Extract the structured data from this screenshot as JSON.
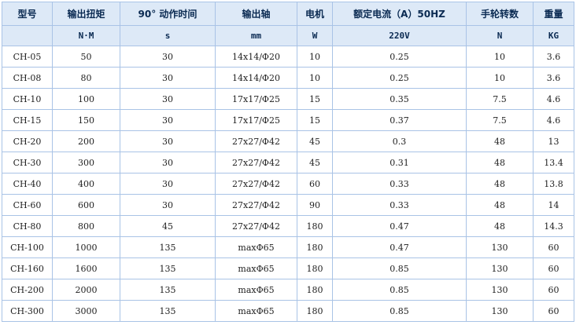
{
  "table": {
    "headers": [
      "型号",
      "输出扭矩",
      "90° 动作时间",
      "输出轴",
      "电机",
      "额定电流（A）50HZ",
      "手轮转数",
      "重量"
    ],
    "units": [
      "",
      "N·M",
      "s",
      "mm",
      "W",
      "220V",
      "N",
      "KG"
    ],
    "rows": [
      [
        "CH-05",
        "50",
        "30",
        "14x14/Φ20",
        "10",
        "0.25",
        "10",
        "3.6"
      ],
      [
        "CH-08",
        "80",
        "30",
        "14x14/Φ20",
        "10",
        "0.25",
        "10",
        "3.6"
      ],
      [
        "CH-10",
        "100",
        "30",
        "17x17/Φ25",
        "15",
        "0.35",
        "7.5",
        "4.6"
      ],
      [
        "CH-15",
        "150",
        "30",
        "17x17/Φ25",
        "15",
        "0.37",
        "7.5",
        "4.6"
      ],
      [
        "CH-20",
        "200",
        "30",
        "27x27/Φ42",
        "45",
        "0.3",
        "48",
        "13"
      ],
      [
        "CH-30",
        "300",
        "30",
        "27x27/Φ42",
        "45",
        "0.31",
        "48",
        "13.4"
      ],
      [
        "CH-40",
        "400",
        "30",
        "27x27/Φ42",
        "60",
        "0.33",
        "48",
        "13.8"
      ],
      [
        "CH-60",
        "600",
        "30",
        "27x27/Φ42",
        "90",
        "0.33",
        "48",
        "14"
      ],
      [
        "CH-80",
        "800",
        "45",
        "27x27/Φ42",
        "180",
        "0.47",
        "48",
        "14.3"
      ],
      [
        "CH-100",
        "1000",
        "135",
        "maxΦ65",
        "180",
        "0.47",
        "130",
        "60"
      ],
      [
        "CH-160",
        "1600",
        "135",
        "maxΦ65",
        "180",
        "0.85",
        "130",
        "60"
      ],
      [
        "CH-200",
        "2000",
        "135",
        "maxΦ65",
        "180",
        "0.85",
        "130",
        "60"
      ],
      [
        "CH-300",
        "3000",
        "135",
        "maxΦ65",
        "180",
        "0.85",
        "130",
        "60"
      ]
    ]
  },
  "colors": {
    "header_bg": "#dde9f7",
    "header_text": "#0a2a52",
    "border": "#a9c3e6",
    "cell_text": "#222222"
  }
}
